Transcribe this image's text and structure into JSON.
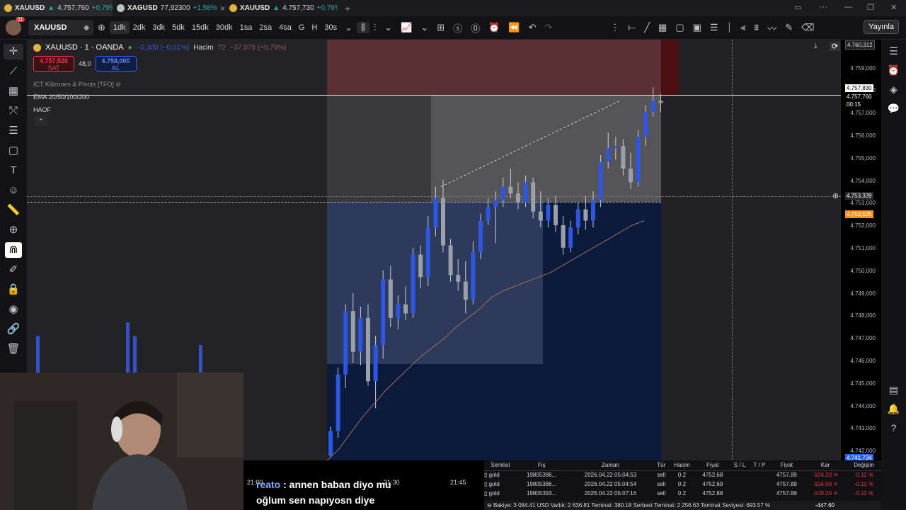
{
  "tabs": [
    {
      "symbol": "XAUUSD",
      "price": "4.757,760",
      "change": "+0,79%",
      "icon": "gold-coin-icon"
    },
    {
      "symbol": "XAGUSD",
      "price": "77,92300",
      "change": "+1,58%",
      "icon": "silver-coin-icon"
    },
    {
      "symbol": "XAUUSD",
      "price": "4.757,730",
      "change": "+0,78%",
      "icon": "gold-coin-icon"
    }
  ],
  "toolbar": {
    "notifications": "11",
    "symbol": "XAUUSD",
    "intervals": [
      "1dk",
      "2dk",
      "3dk",
      "5dk",
      "15dk",
      "30dk",
      "1sa",
      "2sa",
      "4sa",
      "G",
      "H",
      "30s"
    ],
    "selected_interval": "1dk",
    "publish_label": "Yayınla"
  },
  "legend": {
    "title": "XAUUSD · 1 · OANDA",
    "change": "−0,300 (−0,01%)",
    "volume_label": "Hacim",
    "volume_value": "72",
    "volume_change": "−37,075 (+0,79%)",
    "sell_price": "4.757,520",
    "sell_label": "SAT",
    "spread": "48,0",
    "buy_price": "4.758,000",
    "buy_label": "AL"
  },
  "indicators": [
    "ICT Killzones & Pivots [TFO]",
    "EMA 20/50/100/200",
    "HAOF"
  ],
  "price_axis": {
    "top": "4.760,312",
    "ticks": [
      "4.759,000",
      "4.758,000",
      "4.757,000",
      "4.756,000",
      "4.755,000",
      "4.754,000",
      "4.753,000",
      "4.752,000",
      "4.751,000",
      "4.750,000",
      "4.749,000",
      "4.748,000",
      "4.747,000",
      "4.746,000",
      "4.745,000",
      "4.744,000",
      "4.743,000",
      "4.742,000"
    ],
    "label_bid": "4.757,830",
    "label_last": "4.757,760",
    "countdown": "00:15",
    "crosshair": "4.753,339",
    "ema": "4.752,525",
    "bottom": "4.741,734"
  },
  "time_axis": [
    "21:00",
    "21:30",
    "21:45"
  ],
  "chart_data": {
    "type": "candlestick",
    "ylim": [
      4741.7,
      4760.3
    ],
    "colors": {
      "up": "#2f56e0",
      "down": "#9aa0a8",
      "ema": "#a0714f"
    },
    "candles": [
      {
        "o": 4741.9,
        "h": 4743.2,
        "l": 4741.8,
        "c": 4743.0
      },
      {
        "o": 4743.0,
        "h": 4745.8,
        "l": 4742.7,
        "c": 4745.5
      },
      {
        "o": 4745.5,
        "h": 4748.6,
        "l": 4744.9,
        "c": 4748.3
      },
      {
        "o": 4748.3,
        "h": 4749.1,
        "l": 4746.0,
        "c": 4746.5
      },
      {
        "o": 4746.5,
        "h": 4748.5,
        "l": 4745.9,
        "c": 4748.0
      },
      {
        "o": 4748.0,
        "h": 4748.6,
        "l": 4745.0,
        "c": 4745.2
      },
      {
        "o": 4745.2,
        "h": 4747.2,
        "l": 4744.0,
        "c": 4746.8
      },
      {
        "o": 4746.8,
        "h": 4750.1,
        "l": 4746.2,
        "c": 4749.7
      },
      {
        "o": 4749.7,
        "h": 4750.3,
        "l": 4747.6,
        "c": 4748.0
      },
      {
        "o": 4748.0,
        "h": 4749.0,
        "l": 4747.5,
        "c": 4748.6
      },
      {
        "o": 4748.6,
        "h": 4749.4,
        "l": 4747.9,
        "c": 4748.2
      },
      {
        "o": 4748.2,
        "h": 4751.1,
        "l": 4748.0,
        "c": 4750.8
      },
      {
        "o": 4750.8,
        "h": 4751.2,
        "l": 4749.3,
        "c": 4749.8
      },
      {
        "o": 4749.8,
        "h": 4752.5,
        "l": 4749.4,
        "c": 4752.0
      },
      {
        "o": 4752.0,
        "h": 4753.8,
        "l": 4751.6,
        "c": 4753.3
      },
      {
        "o": 4753.3,
        "h": 4754.1,
        "l": 4750.9,
        "c": 4751.2
      },
      {
        "o": 4751.2,
        "h": 4751.5,
        "l": 4749.6,
        "c": 4749.9
      },
      {
        "o": 4749.9,
        "h": 4750.6,
        "l": 4749.2,
        "c": 4749.6
      },
      {
        "o": 4749.6,
        "h": 4750.5,
        "l": 4748.2,
        "c": 4748.8
      },
      {
        "o": 4748.8,
        "h": 4751.4,
        "l": 4748.6,
        "c": 4750.9
      },
      {
        "o": 4750.9,
        "h": 4752.6,
        "l": 4750.6,
        "c": 4752.3
      },
      {
        "o": 4752.3,
        "h": 4753.3,
        "l": 4752.1,
        "c": 4752.9
      },
      {
        "o": 4752.9,
        "h": 4753.6,
        "l": 4751.3,
        "c": 4753.2
      },
      {
        "o": 4753.2,
        "h": 4754.2,
        "l": 4752.9,
        "c": 4753.8
      },
      {
        "o": 4753.8,
        "h": 4754.6,
        "l": 4753.3,
        "c": 4753.5
      },
      {
        "o": 4753.5,
        "h": 4754.0,
        "l": 4752.8,
        "c": 4753.1
      },
      {
        "o": 4753.1,
        "h": 4754.3,
        "l": 4752.9,
        "c": 4754.0
      },
      {
        "o": 4754.0,
        "h": 4754.2,
        "l": 4752.4,
        "c": 4752.7
      },
      {
        "o": 4752.7,
        "h": 4753.6,
        "l": 4752.0,
        "c": 4752.3
      },
      {
        "o": 4752.3,
        "h": 4753.3,
        "l": 4752.0,
        "c": 4753.0
      },
      {
        "o": 4753.0,
        "h": 4753.4,
        "l": 4751.8,
        "c": 4752.1
      },
      {
        "o": 4752.1,
        "h": 4752.5,
        "l": 4750.8,
        "c": 4751.1
      },
      {
        "o": 4751.1,
        "h": 4752.3,
        "l": 4750.9,
        "c": 4752.0
      },
      {
        "o": 4752.0,
        "h": 4753.1,
        "l": 4751.7,
        "c": 4752.8
      },
      {
        "o": 4752.8,
        "h": 4753.4,
        "l": 4751.9,
        "c": 4752.3
      },
      {
        "o": 4752.3,
        "h": 4753.6,
        "l": 4752.0,
        "c": 4753.2
      },
      {
        "o": 4753.2,
        "h": 4755.2,
        "l": 4752.9,
        "c": 4754.9
      },
      {
        "o": 4754.9,
        "h": 4756.2,
        "l": 4754.6,
        "c": 4755.5
      },
      {
        "o": 4755.5,
        "h": 4756.0,
        "l": 4755.0,
        "c": 4755.6
      },
      {
        "o": 4755.6,
        "h": 4755.9,
        "l": 4754.3,
        "c": 4754.6
      },
      {
        "o": 4754.6,
        "h": 4755.3,
        "l": 4753.7,
        "c": 4754.0
      },
      {
        "o": 4754.0,
        "h": 4756.3,
        "l": 4753.8,
        "c": 4756.0
      },
      {
        "o": 4756.0,
        "h": 4757.4,
        "l": 4755.6,
        "c": 4757.1
      },
      {
        "o": 4757.1,
        "h": 4758.2,
        "l": 4756.9,
        "c": 4757.6
      },
      {
        "o": 4757.6,
        "h": 4757.9,
        "l": 4757.1,
        "c": 4757.5
      }
    ],
    "ema": [
      4741.7,
      4742.2,
      4742.9,
      4743.6,
      4744.2,
      4744.8,
      4745.3,
      4745.8,
      4746.3,
      4746.7,
      4747.1,
      4747.6,
      4748.0,
      4748.4,
      4748.9,
      4749.2,
      4749.4,
      4749.6,
      4749.8,
      4750.0,
      4750.3,
      4750.6,
      4750.9,
      4751.2,
      4751.5,
      4751.8,
      4752.1,
      4752.3
    ]
  },
  "webcam_label": "webcam",
  "subtitle": {
    "user": "reato",
    "line1": ": annen baban diyo mu",
    "line2": "oğlum sen napıyosn diye"
  },
  "trades": {
    "headers": [
      "Sembol",
      "Fiş",
      "Zaman",
      "Tür",
      "Hacim",
      "Fiyat",
      "S / L",
      "T / P",
      "Fiyat",
      "Kar",
      "Değişim"
    ],
    "rows": [
      [
        "gold",
        "19805386...",
        "2026.04.22 05:04:53",
        "sell",
        "0.2",
        "4752.68",
        "",
        "",
        "4757.89",
        "-104.20",
        "-0.11 %"
      ],
      [
        "gold",
        "19805386...",
        "2026.04.22 05:04:54",
        "sell",
        "0.2",
        "4752.69",
        "",
        "",
        "4757.89",
        "-104.00",
        "-0.11 %"
      ],
      [
        "gold",
        "19805393...",
        "2026.04.22 05:07:16",
        "sell",
        "0.2",
        "4752.88",
        "",
        "",
        "4757.89",
        "-100.20",
        "-0.11 %"
      ]
    ],
    "footer": "Bakiye: 3 084.41 USD  Varlık: 2 636.81  Teminat: 380.18  Serbest Teminat: 2 256.63  Teminat Seviyesi: 693.57 %",
    "footer_total": "-447.60"
  }
}
